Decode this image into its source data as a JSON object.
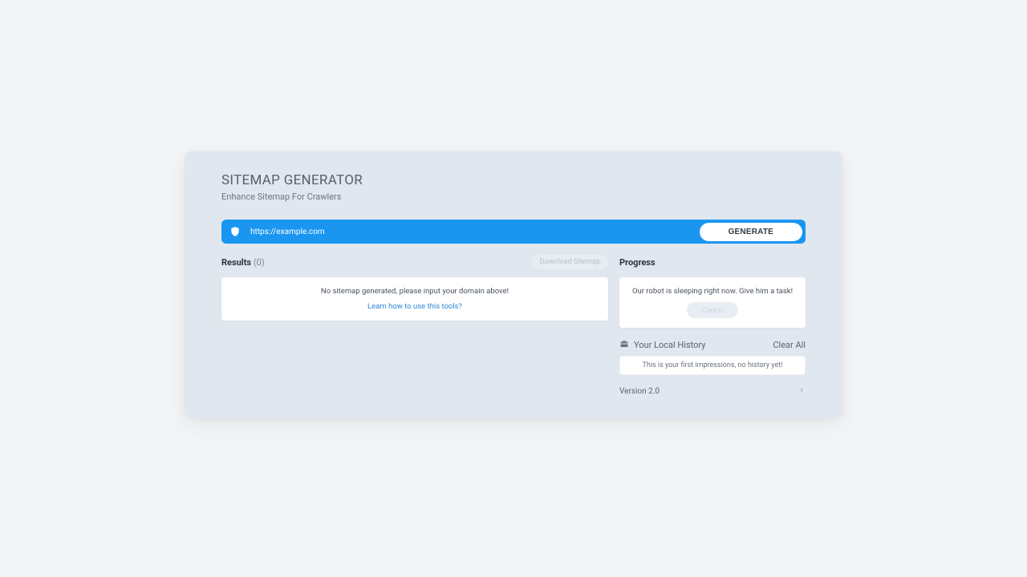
{
  "header": {
    "title": "SITEMAP GENERATOR",
    "subtitle": "Enhance Sitemap For Crawlers"
  },
  "input": {
    "placeholder": "https://example.com",
    "generate_label": "GENERATE"
  },
  "results": {
    "label": "Results",
    "count_display": "(0)",
    "download_label": "Download Sitemap",
    "empty_text": "No sitemap generated, please input your domain above!",
    "learn_link": "Learn how to use this tools?"
  },
  "progress": {
    "label": "Progress",
    "sleep_text": "Our robot is sleeping right now. Give him a task!",
    "cancel_label": "Cancel"
  },
  "history": {
    "title": "Your Local History",
    "clear_label": "Clear All",
    "empty_text": "This is your first impressions, no history yet!"
  },
  "version": {
    "label": "Version 2.0"
  }
}
